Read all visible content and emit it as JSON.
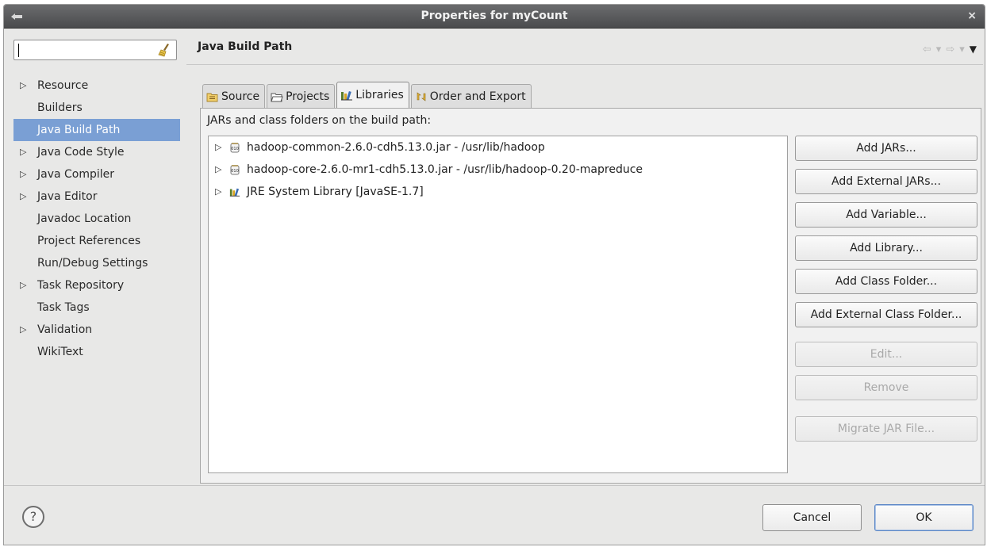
{
  "window": {
    "title": "Properties for myCount",
    "close_glyph": "×"
  },
  "sidebar": {
    "filter": {
      "value": "",
      "placeholder": ""
    },
    "items": [
      {
        "label": "Resource",
        "expandable": true
      },
      {
        "label": "Builders",
        "expandable": false
      },
      {
        "label": "Java Build Path",
        "expandable": false,
        "selected": true
      },
      {
        "label": "Java Code Style",
        "expandable": true
      },
      {
        "label": "Java Compiler",
        "expandable": true
      },
      {
        "label": "Java Editor",
        "expandable": true
      },
      {
        "label": "Javadoc Location",
        "expandable": false
      },
      {
        "label": "Project References",
        "expandable": false
      },
      {
        "label": "Run/Debug Settings",
        "expandable": false
      },
      {
        "label": "Task Repository",
        "expandable": true
      },
      {
        "label": "Task Tags",
        "expandable": false
      },
      {
        "label": "Validation",
        "expandable": true
      },
      {
        "label": "WikiText",
        "expandable": false
      }
    ],
    "expand_glyph": "▷"
  },
  "main": {
    "title": "Java Build Path",
    "nav": {
      "back": "⇦",
      "forward": "⇨",
      "dropdown": "▾",
      "menu": "▼"
    },
    "tabs": [
      {
        "label": "Source",
        "icon": "source-folder-icon"
      },
      {
        "label": "Projects",
        "icon": "projects-folder-icon"
      },
      {
        "label": "Libraries",
        "icon": "libraries-icon",
        "active": true
      },
      {
        "label": "Order and Export",
        "icon": "order-export-icon"
      }
    ],
    "panel_label": "JARs and class folders on the build path:",
    "entries": [
      {
        "label": "hadoop-common-2.6.0-cdh5.13.0.jar - /usr/lib/hadoop",
        "icon": "jar-icon"
      },
      {
        "label": "hadoop-core-2.6.0-mr1-cdh5.13.0.jar - /usr/lib/hadoop-0.20-mapreduce",
        "icon": "jar-icon"
      },
      {
        "label": "JRE System Library [JavaSE-1.7]",
        "icon": "library-icon"
      }
    ],
    "buttons": {
      "add_jars": "Add JARs...",
      "add_external_jars": "Add External JARs...",
      "add_variable": "Add Variable...",
      "add_library": "Add Library...",
      "add_class_folder": "Add Class Folder...",
      "add_external_class_folder": "Add External Class Folder...",
      "edit": "Edit...",
      "remove": "Remove",
      "migrate_jar": "Migrate JAR File..."
    }
  },
  "footer": {
    "help": "?",
    "cancel": "Cancel",
    "ok": "OK"
  },
  "colors": {
    "selection": "#7a9fd4",
    "titlebar": "#58595b",
    "disabled_text": "#a9a9a9"
  }
}
